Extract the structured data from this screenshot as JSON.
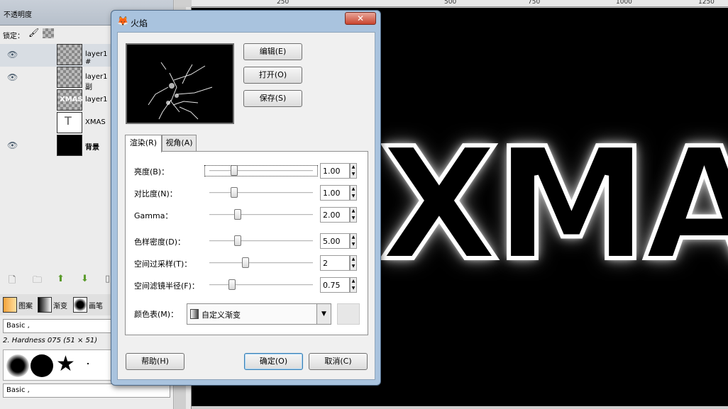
{
  "layers_panel": {
    "opacity_label": "不透明度",
    "lock_label": "锁定：",
    "layers": [
      {
        "name": "layer1 #",
        "visible": true
      },
      {
        "name": "layer1副",
        "visible": true
      },
      {
        "name": "layer1",
        "visible": false
      },
      {
        "name": "XMAS",
        "visible": false
      },
      {
        "name": "背景",
        "visible": true
      }
    ],
    "brush_tabs": [
      "图案",
      "渐变",
      "画笔"
    ],
    "brush_tag": "Basic ,",
    "brush_name": "2. Hardness 075 (51 × 51)",
    "brush_tag2": "Basic ,"
  },
  "ruler": {
    "marks": [
      "250",
      "500",
      "750",
      "1000",
      "1250"
    ]
  },
  "canvas": {
    "text": "XMAS"
  },
  "dialog": {
    "title": "火焰",
    "close": "✕",
    "buttons": {
      "edit": "编辑(E)",
      "open": "打开(O)",
      "save": "保存(S)"
    },
    "tabs": [
      {
        "label": "渲染(R)",
        "active": true
      },
      {
        "label": "视角(A)",
        "active": false
      }
    ],
    "sliders": [
      {
        "label": "亮度(B)：",
        "value": "1.00",
        "level": 0.22
      },
      {
        "label": "对比度(N)：",
        "value": "1.00",
        "level": 0.22
      },
      {
        "label": "Gamma：",
        "value": "2.00",
        "level": 0.26
      },
      {
        "label": "色样密度(D)：",
        "value": "5.00",
        "level": 0.26
      },
      {
        "label": "空间过采样(T)：",
        "value": "2",
        "level": 0.34
      },
      {
        "label": "空间滤镜半径(F)：",
        "value": "0.75",
        "level": 0.2
      }
    ],
    "colormap_label": "颜色表(M)：",
    "colormap_value": "自定义渐变",
    "help": "帮助(H)",
    "ok": "确定(O)",
    "cancel": "取消(C)"
  }
}
